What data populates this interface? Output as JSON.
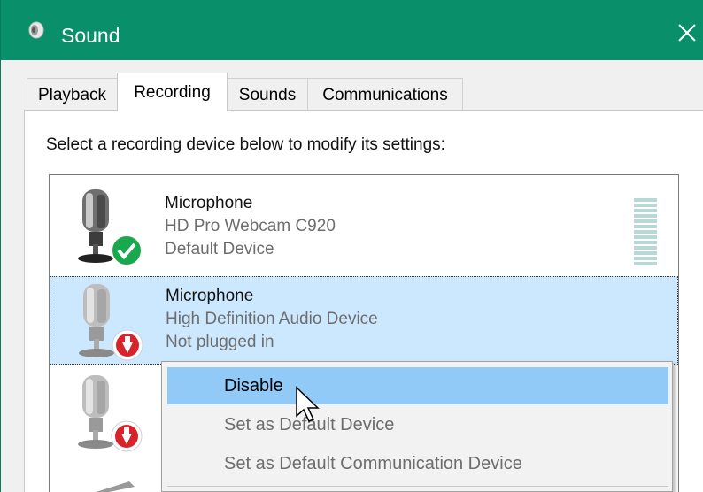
{
  "window": {
    "title": "Sound",
    "close_glyph": "✕",
    "accent_color": "#0a8f6b"
  },
  "tabs": [
    {
      "label": "Playback",
      "active": false
    },
    {
      "label": "Recording",
      "active": true
    },
    {
      "label": "Sounds",
      "active": false
    },
    {
      "label": "Communications",
      "active": false
    }
  ],
  "instruction": "Select a recording device below to modify its settings:",
  "devices": [
    {
      "name": "Microphone",
      "description": "HD Pro Webcam C920",
      "status": "Default Device",
      "badge": "green-check-icon",
      "selected": false
    },
    {
      "name": "Microphone",
      "description": "High Definition Audio Device",
      "status": "Not plugged in",
      "badge": "red-down-arrow-icon",
      "selected": true
    },
    {
      "badge": "red-down-arrow-icon",
      "selected": false
    }
  ],
  "context_menu": {
    "items": [
      {
        "label": "Disable",
        "highlighted": true,
        "enabled": true
      },
      {
        "label": "Set as Default Device",
        "highlighted": false,
        "enabled": false
      },
      {
        "label": "Set as Default Communication Device",
        "highlighted": false,
        "enabled": false
      }
    ]
  }
}
